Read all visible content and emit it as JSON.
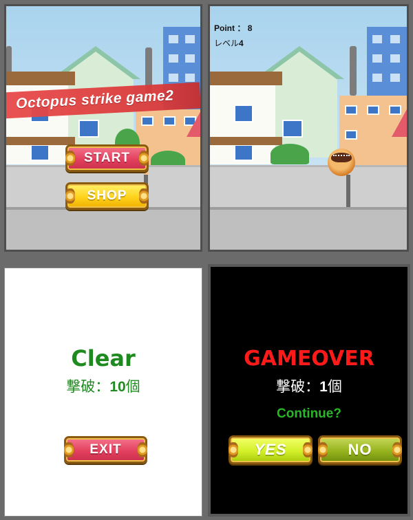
{
  "title_screen": {
    "title": "Octopus strike game2",
    "start_label": "START",
    "shop_label": "SHOP"
  },
  "gameplay": {
    "point_label": "Point",
    "point_sep": "：",
    "point_value": "8",
    "level_label": "レベル",
    "level_value": "4"
  },
  "clear_screen": {
    "heading": "Clear",
    "defeat_label": "撃破：",
    "defeat_count": "10",
    "defeat_unit": "個",
    "exit_label": "EXIT"
  },
  "gameover_screen": {
    "heading": "GAMEOVER",
    "defeat_label": "撃破：",
    "defeat_count": "1",
    "defeat_unit": "個",
    "continue_prompt": "Continue?",
    "yes_label": "YES",
    "no_label": "NO"
  },
  "colors": {
    "clear_green": "#1f8a1f",
    "gameover_red": "#ff1a1a",
    "continue_green": "#2bb52b"
  }
}
